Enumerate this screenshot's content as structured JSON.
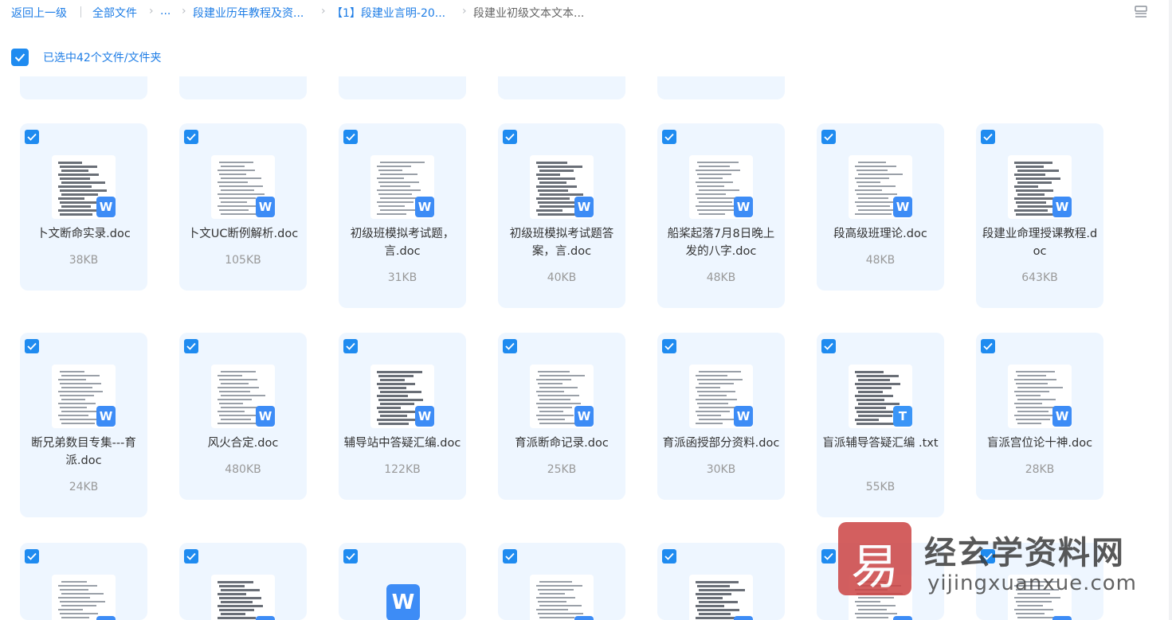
{
  "breadcrumb": {
    "back": "返回上一级",
    "all_files": "全部文件",
    "ellipsis": "...",
    "level1": "段建业历年教程及资...",
    "level2": "【1】段建业言明-20...",
    "current": "段建业初级文本文本..."
  },
  "selection": {
    "label": "已选中42个文件/文件夹",
    "checked": true
  },
  "icons": {
    "view_toggle": "list-view-icon",
    "check": "check-icon",
    "doc_badge": "W",
    "txt_badge": "T"
  },
  "colors": {
    "accent": "#1f8bf0",
    "card_bg": "#eef6ff",
    "doc_badge": "#3d8cf6",
    "link": "#1e7de6",
    "muted": "#999999"
  },
  "files": [
    {
      "name": "卜文断命实录.doc",
      "size": "38KB",
      "type": "doc",
      "selected": true
    },
    {
      "name": "卜文UC断例解析.doc",
      "size": "105KB",
      "type": "doc",
      "selected": true
    },
    {
      "name": "初级班模拟考试题，言.doc",
      "size": "31KB",
      "type": "doc",
      "selected": true
    },
    {
      "name": "初级班模拟考试题答案，言.doc",
      "size": "40KB",
      "type": "doc",
      "selected": true
    },
    {
      "name": "船桨起落7月8日晚上发的八字.doc",
      "size": "48KB",
      "type": "doc",
      "selected": true
    },
    {
      "name": "段高级班理论.doc",
      "size": "48KB",
      "type": "doc",
      "selected": true
    },
    {
      "name": "段建业命理授课教程.doc",
      "size": "643KB",
      "type": "doc",
      "selected": true
    },
    {
      "name": "断兄弟数目专集---育派.doc",
      "size": "24KB",
      "type": "doc",
      "selected": true
    },
    {
      "name": "风火合定.doc",
      "size": "480KB",
      "type": "doc",
      "selected": true
    },
    {
      "name": "辅导站中答疑汇编.doc",
      "size": "122KB",
      "type": "doc",
      "selected": true
    },
    {
      "name": "育派断命记录.doc",
      "size": "25KB",
      "type": "doc",
      "selected": true
    },
    {
      "name": "育派函授部分资料.doc",
      "size": "30KB",
      "type": "doc",
      "selected": true
    },
    {
      "name": "盲派辅导答疑汇编 .txt",
      "size": "55KB",
      "type": "txt",
      "selected": true
    },
    {
      "name": "盲派宫位论十神.doc",
      "size": "28KB",
      "type": "doc",
      "selected": true
    },
    {
      "name": "",
      "size": "",
      "type": "doc",
      "selected": true
    },
    {
      "name": "",
      "size": "",
      "type": "doc",
      "selected": true
    },
    {
      "name": "",
      "size": "",
      "type": "doc",
      "selected": true
    },
    {
      "name": "",
      "size": "",
      "type": "doc",
      "selected": true
    },
    {
      "name": "",
      "size": "",
      "type": "doc",
      "selected": true
    },
    {
      "name": "",
      "size": "",
      "type": "doc",
      "selected": true
    },
    {
      "name": "",
      "size": "",
      "type": "doc",
      "selected": true
    }
  ],
  "watermark": {
    "seal": "易",
    "title": "经玄学资料网",
    "url": "yijingxuanxue.com"
  }
}
